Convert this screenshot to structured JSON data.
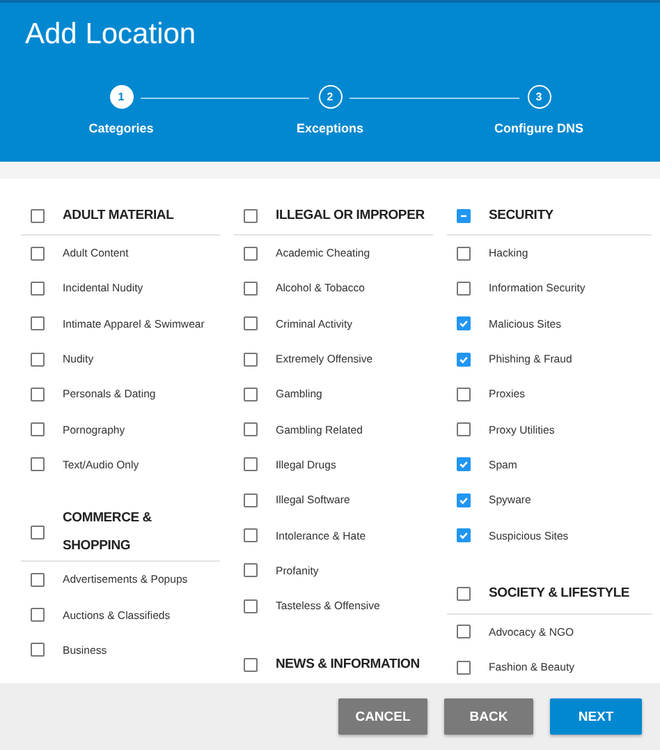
{
  "title": "Add Location",
  "steps": [
    {
      "number": "1",
      "label": "Categories",
      "selected": true
    },
    {
      "number": "2",
      "label": "Exceptions",
      "selected": false
    },
    {
      "number": "3",
      "label": "Configure DNS",
      "selected": false
    }
  ],
  "columns": [
    {
      "groups": [
        {
          "title": "ADULT MATERIAL",
          "checked": false,
          "indeterminate": false,
          "items": [
            {
              "label": "Adult Content",
              "checked": false
            },
            {
              "label": "Incidental Nudity",
              "checked": false
            },
            {
              "label": "Intimate Apparel & Swimwear",
              "checked": false
            },
            {
              "label": "Nudity",
              "checked": false
            },
            {
              "label": "Personals & Dating",
              "checked": false
            },
            {
              "label": "Pornography",
              "checked": false
            },
            {
              "label": "Text/Audio Only",
              "checked": false
            }
          ]
        },
        {
          "title": "COMMERCE & SHOPPING",
          "checked": false,
          "indeterminate": false,
          "items": [
            {
              "label": "Advertisements & Popups",
              "checked": false
            },
            {
              "label": "Auctions & Classifieds",
              "checked": false
            },
            {
              "label": "Business",
              "checked": false
            }
          ]
        }
      ]
    },
    {
      "groups": [
        {
          "title": "ILLEGAL OR IMPROPER",
          "checked": false,
          "indeterminate": false,
          "items": [
            {
              "label": "Academic Cheating",
              "checked": false
            },
            {
              "label": "Alcohol & Tobacco",
              "checked": false
            },
            {
              "label": "Criminal Activity",
              "checked": false
            },
            {
              "label": "Extremely Offensive",
              "checked": false
            },
            {
              "label": "Gambling",
              "checked": false
            },
            {
              "label": "Gambling Related",
              "checked": false
            },
            {
              "label": "Illegal Drugs",
              "checked": false
            },
            {
              "label": "Illegal Software",
              "checked": false
            },
            {
              "label": "Intolerance & Hate",
              "checked": false
            },
            {
              "label": "Profanity",
              "checked": false
            },
            {
              "label": "Tasteless & Offensive",
              "checked": false
            }
          ]
        },
        {
          "title": "NEWS & INFORMATION",
          "checked": false,
          "indeterminate": false
        }
      ]
    },
    {
      "groups": [
        {
          "title": "SECURITY",
          "checked": false,
          "indeterminate": true,
          "items": [
            {
              "label": "Hacking",
              "checked": false
            },
            {
              "label": "Information Security",
              "checked": false
            },
            {
              "label": "Malicious Sites",
              "checked": true
            },
            {
              "label": "Phishing & Fraud",
              "checked": true
            },
            {
              "label": "Proxies",
              "checked": false
            },
            {
              "label": "Proxy Utilities",
              "checked": false
            },
            {
              "label": "Spam",
              "checked": true
            },
            {
              "label": "Spyware",
              "checked": true
            },
            {
              "label": "Suspicious Sites",
              "checked": true
            }
          ]
        },
        {
          "title": "SOCIETY & LIFESTYLE",
          "checked": false,
          "indeterminate": false,
          "items": [
            {
              "label": "Advocacy & NGO",
              "checked": false
            },
            {
              "label": "Fashion & Beauty",
              "checked": false
            }
          ]
        }
      ]
    }
  ],
  "buttons": [
    {
      "label": "CANCEL",
      "kind": "secondary"
    },
    {
      "label": "BACK",
      "kind": "secondary"
    },
    {
      "label": "NEXT",
      "kind": "primary"
    }
  ]
}
